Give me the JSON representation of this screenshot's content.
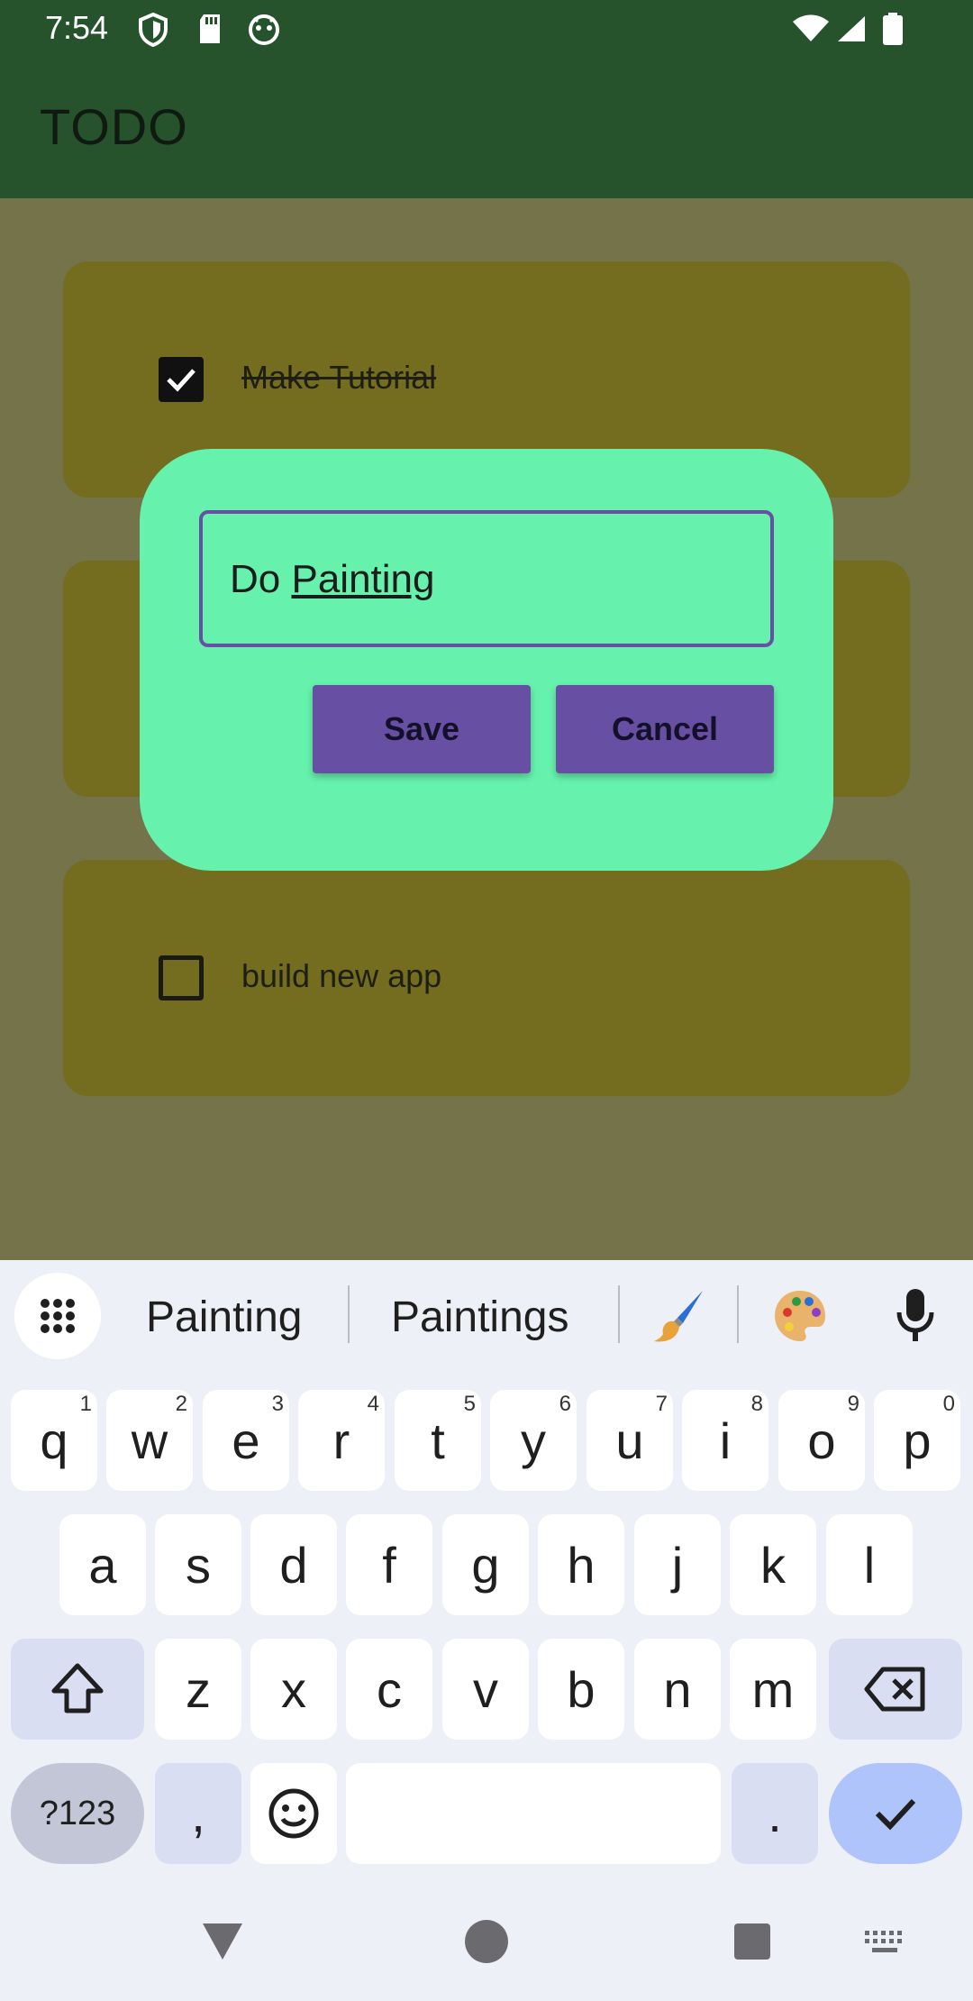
{
  "status_bar": {
    "time": "7:54"
  },
  "app_bar": {
    "title": "TODO"
  },
  "todos": [
    {
      "label": "Make Tutorial",
      "checked": true
    },
    {
      "label": "",
      "checked": false
    },
    {
      "label": "build new app",
      "checked": false
    }
  ],
  "dialog": {
    "input_value_prefix": "Do ",
    "input_value_composing": "Painting",
    "save_label": "Save",
    "cancel_label": "Cancel"
  },
  "keyboard": {
    "suggestions": [
      "Painting",
      "Paintings"
    ],
    "emoji_suggestions": [
      "paintbrush-emoji",
      "palette-emoji"
    ],
    "row1": [
      {
        "key": "q",
        "hint": "1"
      },
      {
        "key": "w",
        "hint": "2"
      },
      {
        "key": "e",
        "hint": "3"
      },
      {
        "key": "r",
        "hint": "4"
      },
      {
        "key": "t",
        "hint": "5"
      },
      {
        "key": "y",
        "hint": "6"
      },
      {
        "key": "u",
        "hint": "7"
      },
      {
        "key": "i",
        "hint": "8"
      },
      {
        "key": "o",
        "hint": "9"
      },
      {
        "key": "p",
        "hint": "0"
      }
    ],
    "row2": [
      "a",
      "s",
      "d",
      "f",
      "g",
      "h",
      "j",
      "k",
      "l"
    ],
    "row3": [
      "z",
      "x",
      "c",
      "v",
      "b",
      "n",
      "m"
    ],
    "symbols_label": "?123",
    "comma_label": ",",
    "period_label": "."
  },
  "colors": {
    "app_bar": "#26522c",
    "dialog": "#66f2ad",
    "accent": "#6750a4",
    "card": "#746c1f",
    "scrim": "#75734a"
  }
}
